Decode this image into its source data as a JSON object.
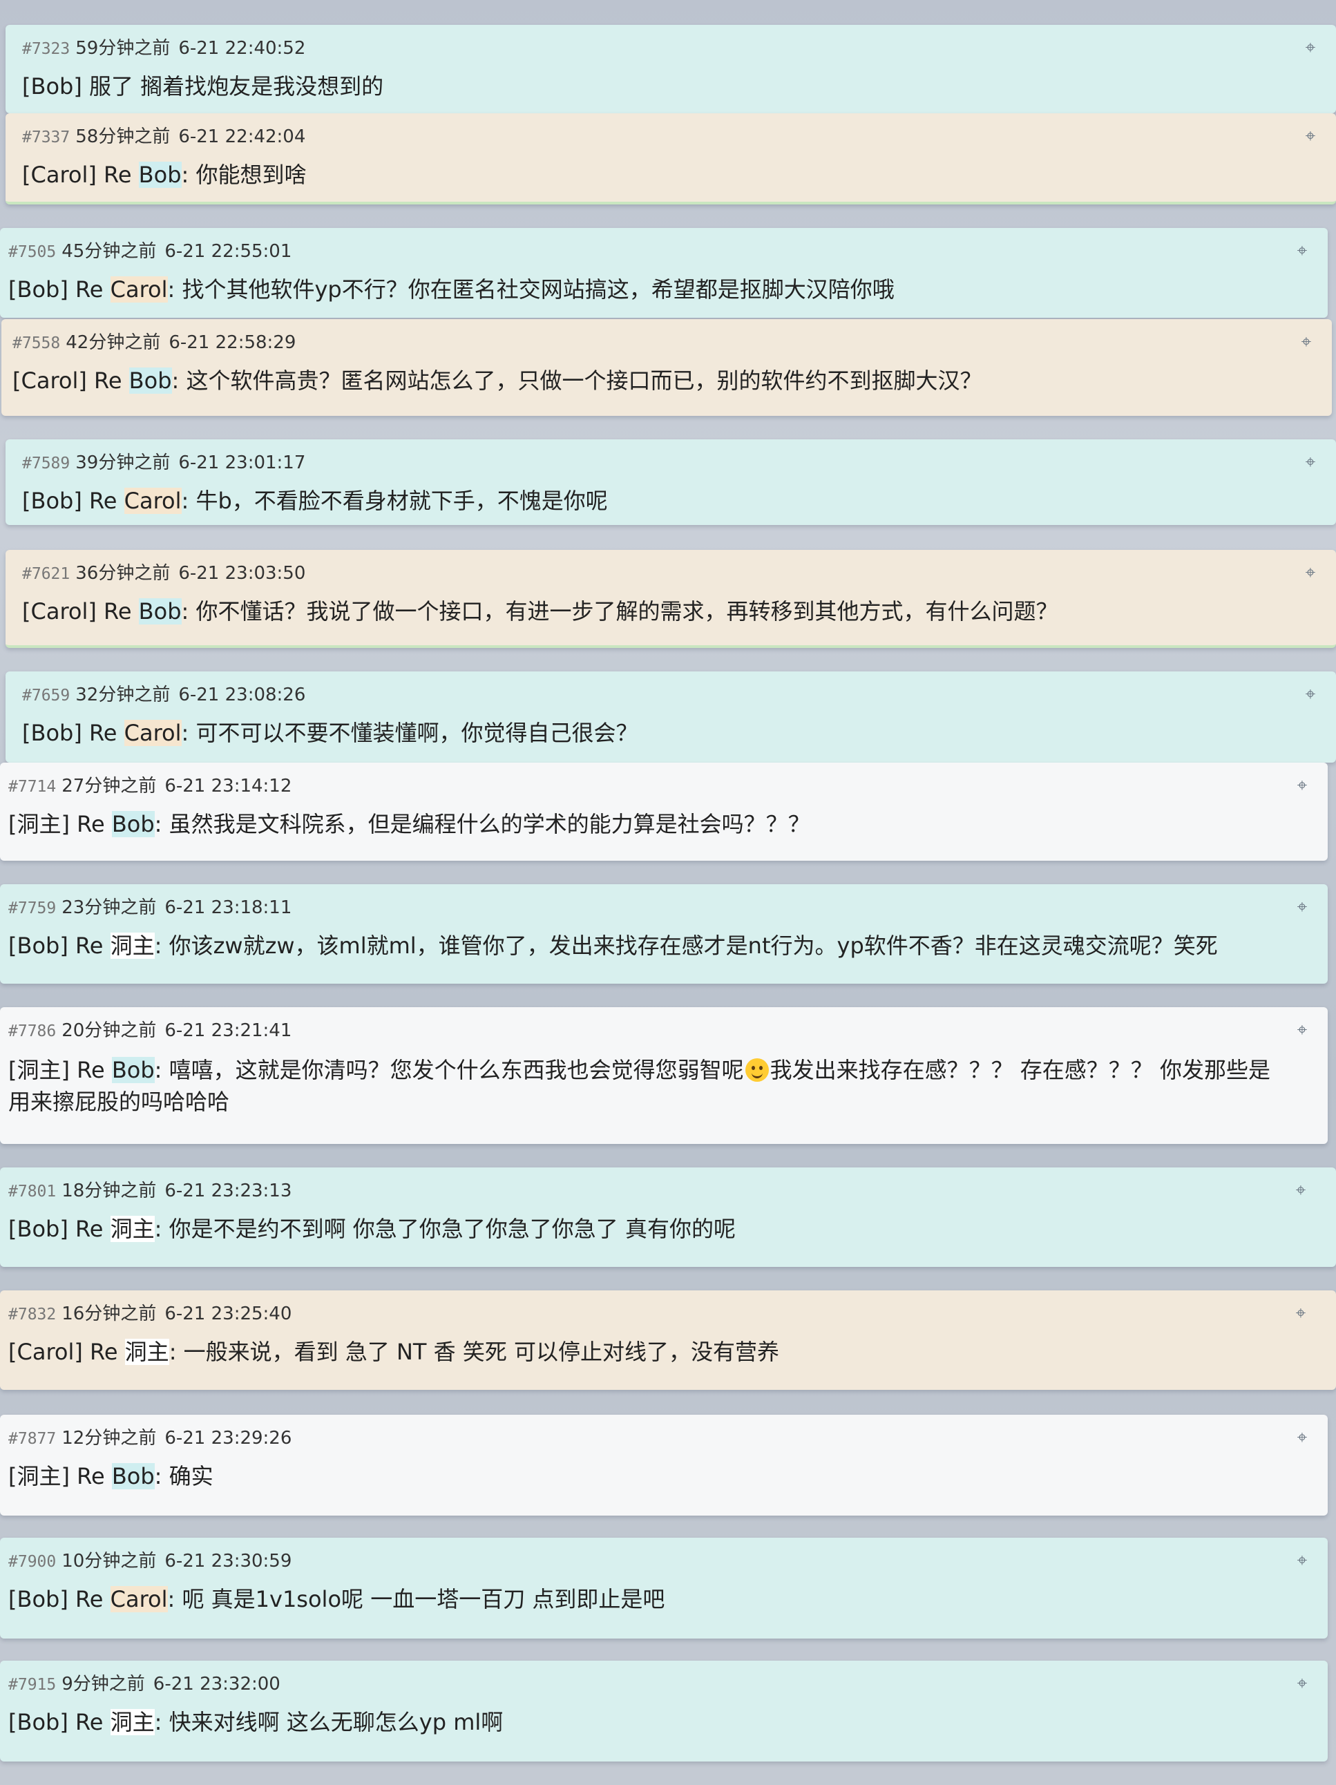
{
  "posts": [
    {
      "id": "#7323",
      "ago": "59分钟之前",
      "datetime": "6-21 22:40:52",
      "author": "[Bob]",
      "reply_prefix": "",
      "reply_to": "",
      "text": "服了 搁着找炮友是我没想到的"
    },
    {
      "id": "#7337",
      "ago": "58分钟之前",
      "datetime": "6-21 22:42:04",
      "author": "[Carol]",
      "reply_prefix": "Re",
      "reply_to": "Bob",
      "text": ": 你能想到啥"
    },
    {
      "id": "#7505",
      "ago": "45分钟之前",
      "datetime": "6-21 22:55:01",
      "author": "[Bob]",
      "reply_prefix": "Re",
      "reply_to": "Carol",
      "text": ": 找个其他软件yp不行？你在匿名社交网站搞这，希望都是抠脚大汉陪你哦"
    },
    {
      "id": "#7558",
      "ago": "42分钟之前",
      "datetime": "6-21 22:58:29",
      "author": "[Carol]",
      "reply_prefix": "Re",
      "reply_to": "Bob",
      "text": ": 这个软件高贵？匿名网站怎么了，只做一个接口而已，别的软件约不到抠脚大汉？"
    },
    {
      "id": "#7589",
      "ago": "39分钟之前",
      "datetime": "6-21 23:01:17",
      "author": "[Bob]",
      "reply_prefix": "Re",
      "reply_to": "Carol",
      "text": ": 牛b，不看脸不看身材就下手，不愧是你呢"
    },
    {
      "id": "#7621",
      "ago": "36分钟之前",
      "datetime": "6-21 23:03:50",
      "author": "[Carol]",
      "reply_prefix": "Re",
      "reply_to": "Bob",
      "text": ": 你不懂话？我说了做一个接口，有进一步了解的需求，再转移到其他方式，有什么问题？"
    },
    {
      "id": "#7659",
      "ago": "32分钟之前",
      "datetime": "6-21 23:08:26",
      "author": "[Bob]",
      "reply_prefix": "Re",
      "reply_to": "Carol",
      "text": ": 可不可以不要不懂装懂啊，你觉得自己很会？"
    },
    {
      "id": "#7714",
      "ago": "27分钟之前",
      "datetime": "6-21 23:14:12",
      "author": "[洞主]",
      "reply_prefix": "Re",
      "reply_to": "Bob",
      "text": ": 虽然我是文科院系，但是编程什么的学术的能力算是社会吗？？？"
    },
    {
      "id": "#7759",
      "ago": "23分钟之前",
      "datetime": "6-21 23:18:11",
      "author": "[Bob]",
      "reply_prefix": "Re",
      "reply_to": "洞主",
      "text": ": 你该zw就zw，该ml就ml，谁管你了，发出来找存在感才是nt行为。yp软件不香？非在这灵魂交流呢？笑死"
    },
    {
      "id": "#7786",
      "ago": "20分钟之前",
      "datetime": "6-21 23:21:41",
      "author": "[洞主]",
      "reply_prefix": "Re",
      "reply_to": "Bob",
      "text": ": 嘻嘻，这就是你清吗？您发个什么东西我也会觉得您弱智呢",
      "text_after_emoji": "我发出来找存在感？？？ 存在感？？？ 你发那些是用来擦屁股的吗哈哈哈",
      "emoji": "smiling-face"
    },
    {
      "id": "#7801",
      "ago": "18分钟之前",
      "datetime": "6-21 23:23:13",
      "author": "[Bob]",
      "reply_prefix": "Re",
      "reply_to": "洞主",
      "text": ": 你是不是约不到啊 你急了你急了你急了你急了 真有你的呢"
    },
    {
      "id": "#7832",
      "ago": "16分钟之前",
      "datetime": "6-21 23:25:40",
      "author": "[Carol]",
      "reply_prefix": "Re",
      "reply_to": "洞主",
      "text": ": 一般来说，看到 急了 NT 香 笑死 可以停止对线了，没有营养"
    },
    {
      "id": "#7877",
      "ago": "12分钟之前",
      "datetime": "6-21 23:29:26",
      "author": "[洞主]",
      "reply_prefix": "Re",
      "reply_to": "Bob",
      "text": ": 确实"
    },
    {
      "id": "#7900",
      "ago": "10分钟之前",
      "datetime": "6-21 23:30:59",
      "author": "[Bob]",
      "reply_prefix": "Re",
      "reply_to": "Carol",
      "text": ": 呃 真是1v1solo呢 一血一塔一百刀 点到即止是吧"
    },
    {
      "id": "#7915",
      "ago": "9分钟之前",
      "datetime": "6-21 23:32:00",
      "author": "[Bob]",
      "reply_prefix": "Re",
      "reply_to": "洞主",
      "text": ": 快来对线啊 这么无聊怎么yp ml啊"
    }
  ],
  "icons": {
    "locate": "crosshair-icon",
    "emoji": "smiling-face-emoji"
  },
  "colors": {
    "bob": "#d8f0ee",
    "carol": "#f2e9db",
    "host": "#f6f7f8",
    "background": "#c4cad3"
  }
}
